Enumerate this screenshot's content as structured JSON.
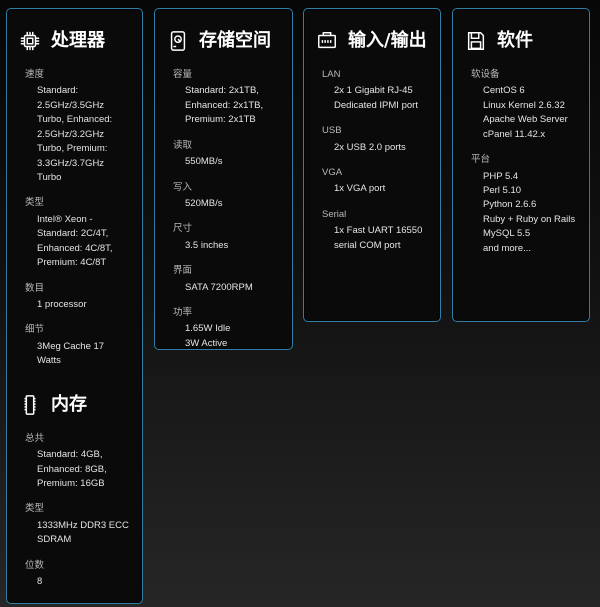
{
  "processor": {
    "title": "处理器",
    "icon": "cpu-chip-icon",
    "specs": [
      {
        "label": "速度",
        "value": "Standard:\n2.5GHz/3.5GHz\nTurbo, Enhanced:\n2.5GHz/3.2GHz\nTurbo, Premium:\n3.3GHz/3.7GHz\nTurbo"
      },
      {
        "label": "类型",
        "value": "Intel® Xeon -\nStandard: 2C/4T,\nEnhanced: 4C/8T,\nPremium: 4C/8T"
      },
      {
        "label": "数目",
        "value": "1 processor"
      },
      {
        "label": "细节",
        "value": "3Meg Cache 17\nWatts"
      }
    ]
  },
  "memory": {
    "title": "内存",
    "icon": "memory-stick-icon",
    "specs": [
      {
        "label": "总共",
        "value": "Standard: 4GB,\nEnhanced: 8GB,\nPremium: 16GB"
      },
      {
        "label": "类型",
        "value": "1333MHz DDR3 ECC\nSDRAM"
      },
      {
        "label": "位数",
        "value": "8"
      }
    ]
  },
  "storage": {
    "title": "存储空间",
    "icon": "hard-drive-icon",
    "specs": [
      {
        "label": "容量",
        "value": "Standard: 2x1TB,\nEnhanced: 2x1TB,\nPremium: 2x1TB"
      },
      {
        "label": "读取",
        "value": "550MB/s"
      },
      {
        "label": "写入",
        "value": "520MB/s"
      },
      {
        "label": "尺寸",
        "value": "3.5 inches"
      },
      {
        "label": "界面",
        "value": "SATA 7200RPM"
      },
      {
        "label": "功率",
        "value": "1.65W Idle\n3W Active"
      }
    ]
  },
  "io": {
    "title": "输入/输出",
    "icon": "network-port-icon",
    "specs": [
      {
        "label": "LAN",
        "value": "2x 1 Gigabit RJ-45\nDedicated IPMI port"
      },
      {
        "label": "USB",
        "value": "2x USB 2.0 ports"
      },
      {
        "label": "VGA",
        "value": "1x VGA port"
      },
      {
        "label": "Serial",
        "value": "1x Fast UART 16550\nserial COM port"
      }
    ]
  },
  "software": {
    "title": "软件",
    "icon": "floppy-disk-icon",
    "specs": [
      {
        "label": "软设备",
        "value": "CentOS 6\nLinux Kernel 2.6.32\nApache Web Server\ncPanel 11.42.x"
      },
      {
        "label": "平台",
        "value": "PHP 5.4\nPerl 5.10\nPython 2.6.6\nRuby + Ruby on Rails\nMySQL 5.5\nand more..."
      }
    ]
  }
}
